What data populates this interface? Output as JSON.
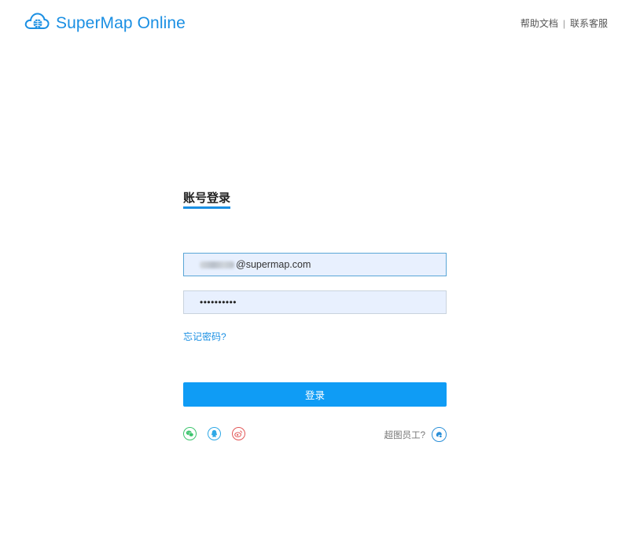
{
  "header": {
    "brand": "SuperMap Online",
    "links": [
      {
        "label": "帮助文档"
      },
      {
        "label": "联系客服"
      }
    ],
    "separator": "|"
  },
  "login": {
    "title": "账号登录",
    "email_value": "@supermap.com",
    "password_value": "••••••••••",
    "forgot_label": "忘记密码?",
    "submit_label": "登录",
    "social": [
      {
        "icon": "wechat-icon",
        "color": "#3cc46d"
      },
      {
        "icon": "qq-icon",
        "color": "#2ea8e6"
      },
      {
        "icon": "weibo-icon",
        "color": "#e25656"
      }
    ],
    "staff_label": "超图员工?",
    "staff_icon": "supermap-staff-icon"
  },
  "colors": {
    "brand": "#1a8fe3",
    "button": "#0f9cf5",
    "input_bg": "#e8f0fe"
  }
}
